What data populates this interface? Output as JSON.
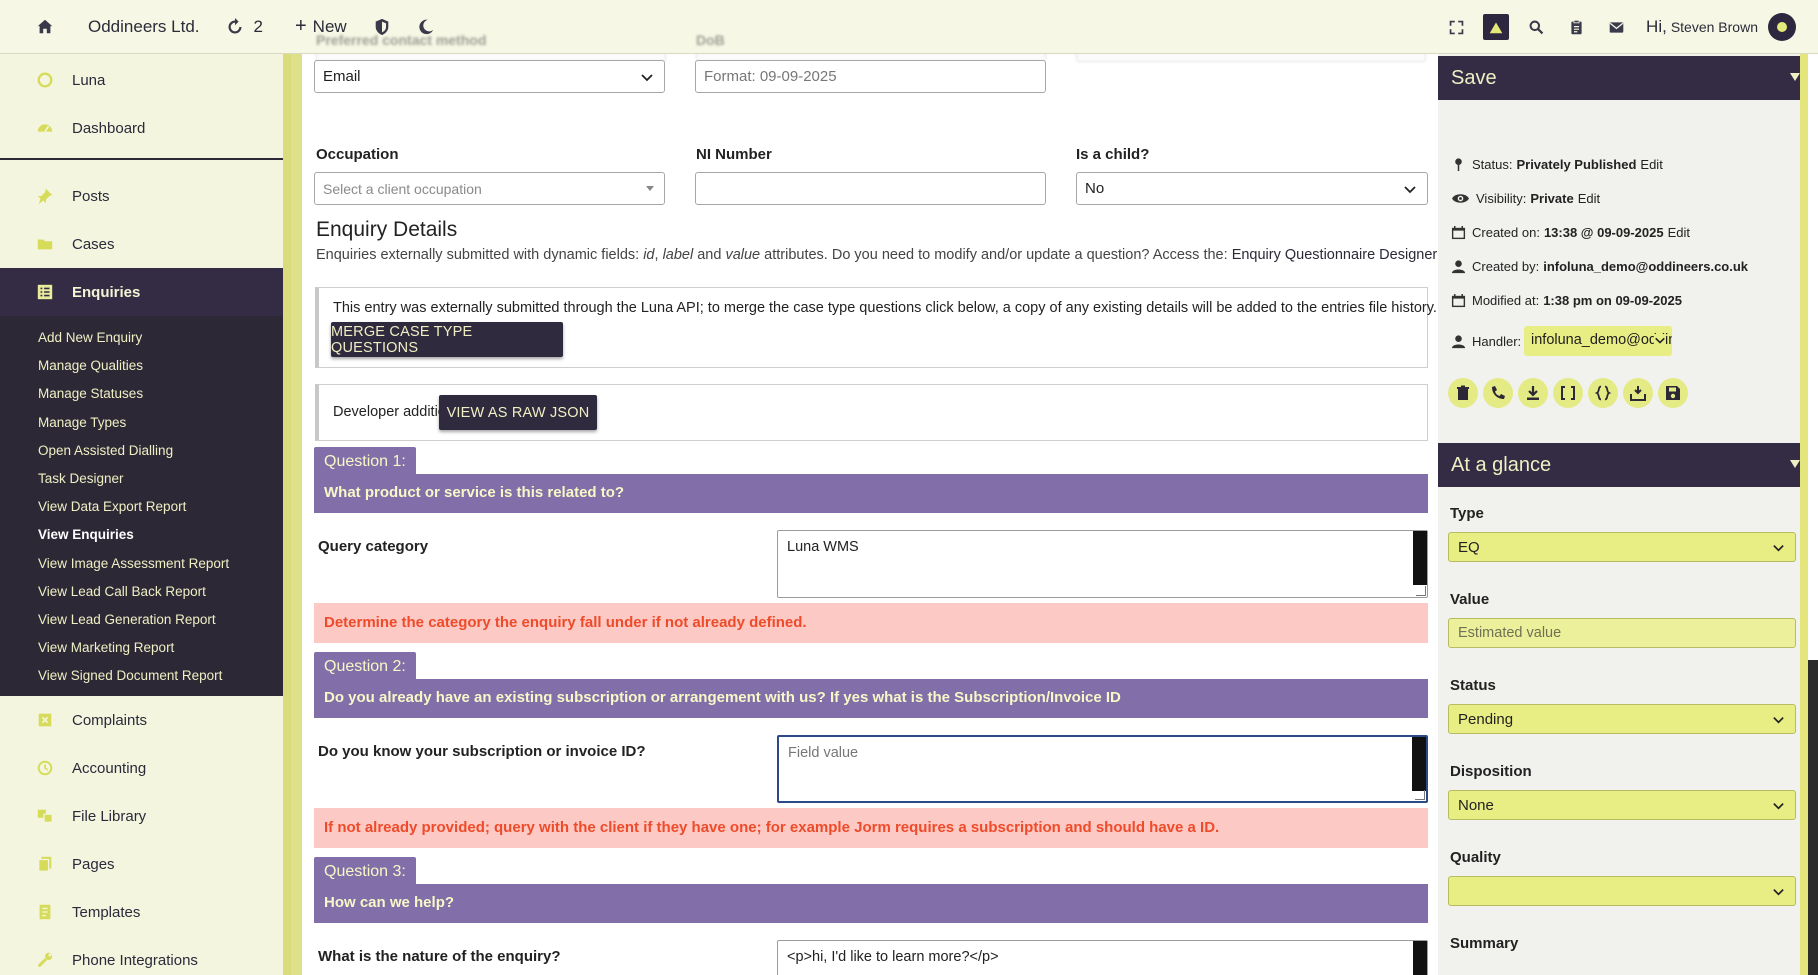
{
  "topbar": {
    "site_name": "Oddineers Ltd.",
    "updates_count": "2",
    "new_label": "New",
    "greeting": "Hi,",
    "user_name": "Steven Brown"
  },
  "sidebar": {
    "top_items": [
      {
        "label": "Luna",
        "icon": "luna-circle-icon"
      },
      {
        "label": "Dashboard",
        "icon": "dashboard-gauge-icon"
      }
    ],
    "items": [
      {
        "label": "Posts",
        "icon": "pin-icon"
      },
      {
        "label": "Cases",
        "icon": "folder-icon"
      },
      {
        "label": "Enquiries",
        "icon": "enquiries-list-icon"
      }
    ],
    "submenu": [
      "Add New Enquiry",
      "Manage Qualities",
      "Manage Statuses",
      "Manage Types",
      "Open Assisted Dialling",
      "Task Designer",
      "View Data Export Report",
      "View Enquiries",
      "View Image Assessment Report",
      "View Lead Call Back Report",
      "View Lead Generation Report",
      "View Marketing Report",
      "View Signed Document Report"
    ],
    "bottom_items": [
      {
        "label": "Complaints",
        "icon": "complaints-icon"
      },
      {
        "label": "Accounting",
        "icon": "clock-icon"
      },
      {
        "label": "File Library",
        "icon": "media-icon"
      },
      {
        "label": "Pages",
        "icon": "pages-icon"
      },
      {
        "label": "Templates",
        "icon": "templates-icon"
      },
      {
        "label": "Phone Integrations",
        "icon": "wrench-icon"
      }
    ]
  },
  "main": {
    "ghost_labels": {
      "contact_method": "Preferred contact method",
      "dob": "DoB"
    },
    "contact_method_value": "Email",
    "dob_placeholder": "Format: 09-09-2025",
    "occupation_label": "Occupation",
    "occupation_placeholder": "Select a client occupation",
    "ni_label": "NI Number",
    "ni_value": "",
    "child_label": "Is a child?",
    "child_value": "No",
    "enquiry_title": "Enquiry Details",
    "desc": {
      "part1": "Enquiries externally submitted with dynamic fields: ",
      "f1": "id",
      "sep1": ", ",
      "f2": "label",
      "sep2": " and ",
      "f3": "value",
      "part2": " attributes. Do you need to modify and/or update a question? Access the: ",
      "link": "Enquiry Questionnaire Designer"
    },
    "api_notice": "This entry was externally submitted through the Luna API; to merge the case type questions click below, a copy of any existing details will be added to the entries file history.",
    "merge_button": "MERGE CASE TYPE QUESTIONS",
    "dev_label": "Developer addition:",
    "json_button": "VIEW AS RAW JSON",
    "questions": [
      {
        "tab": "Question 1:",
        "question": "What product or service is this related to?",
        "field_label": "Query category",
        "value": "Luna WMS",
        "placeholder": "",
        "help": "Determine the category the enquiry fall under if not already defined."
      },
      {
        "tab": "Question 2:",
        "question": "Do you already have an existing subscription or arrangement with us? If yes what is the Subscription/Invoice ID",
        "field_label": "Do you know your subscription or invoice ID?",
        "value": "",
        "placeholder": "Field value",
        "help": "If not already provided; query with the client if they have one; for example Jorm requires a subscription and should have a ID."
      },
      {
        "tab": "Question 3:",
        "question": "How can we help?",
        "field_label": "What is the nature of the enquiry?",
        "value": "<p>hi, I'd like to learn more?</p>",
        "placeholder": ""
      }
    ]
  },
  "save_panel": {
    "title": "Save",
    "status_label": "Status:",
    "status_value": "Privately Published",
    "visibility_label": "Visibility:",
    "visibility_value": "Private",
    "created_on_label": "Created on:",
    "created_on_value": "13:38 @ 09-09-2025",
    "created_by_label": "Created by:",
    "created_by_value": "infoluna_demo@oddineers.co.uk",
    "modified_label": "Modified at:",
    "modified_value": "1:38 pm on 09-09-2025",
    "edit_label": "Edit",
    "handler_label": "Handler:",
    "handler_value": "infoluna_demo@oddineers.co.uk",
    "actions": [
      "trash-icon",
      "phone-icon",
      "download-icon",
      "brackets-icon",
      "braces-icon",
      "inbox-download-icon",
      "floppy-save-icon"
    ]
  },
  "glance_panel": {
    "title": "At a glance",
    "type_label": "Type",
    "type_value": "EQ",
    "value_label": "Value",
    "value_placeholder": "Estimated value",
    "status_label": "Status",
    "status_value": "Pending",
    "disposition_label": "Disposition",
    "disposition_value": "None",
    "quality_label": "Quality",
    "quality_value": "",
    "summary_label": "Summary"
  },
  "colors": {
    "brand_dark": "#332c44",
    "accent_lime": "#e8ed84",
    "question_purple": "#826ea8",
    "help_bg": "#fdc9c4",
    "help_text": "#ee4b2b"
  }
}
